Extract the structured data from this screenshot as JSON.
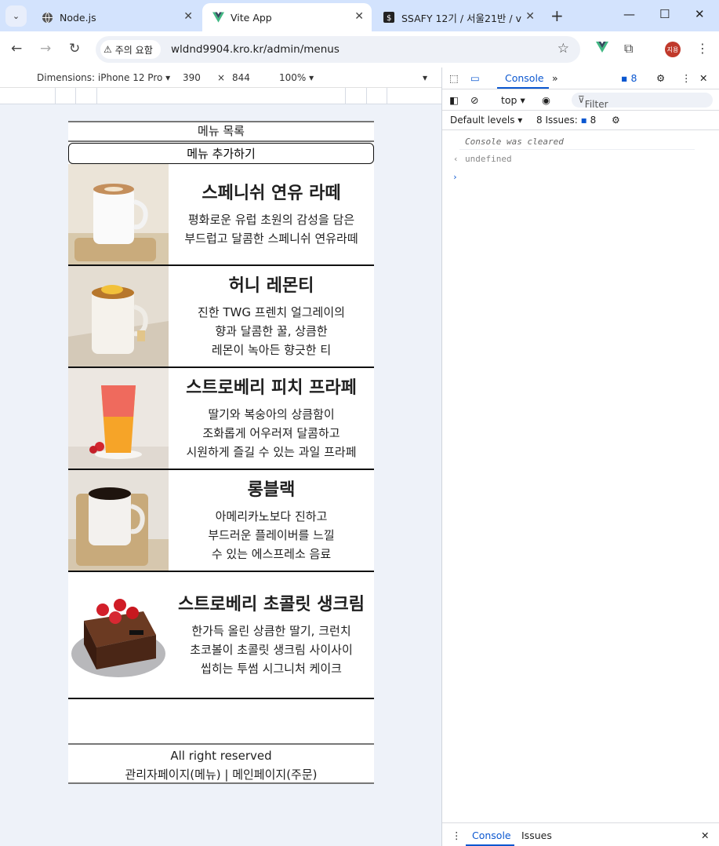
{
  "browser": {
    "tabs": [
      {
        "title": "Node.js",
        "active": false
      },
      {
        "title": "Vite App",
        "active": true
      },
      {
        "title": "SSAFY 12기 / 서울21반 / v",
        "active": false
      }
    ],
    "security_chip": "주의 요함",
    "url": "wldnd9904.kro.kr/admin/menus",
    "profile_initials": "지용"
  },
  "device_toolbar": {
    "dimensions_label": "Dimensions: iPhone 12 Pro",
    "width": "390",
    "times": "×",
    "height": "844",
    "zoom": "100%"
  },
  "app": {
    "header_title": "메뉴 목록",
    "add_button": "메뉴 추가하기",
    "menus": [
      {
        "name": "스페니쉬 연유 라떼",
        "desc_lines": [
          "평화로운 유럽 초원의 감성을 담은",
          "부드럽고 달콤한 스페니쉬 연유라떼"
        ]
      },
      {
        "name": "허니 레몬티",
        "desc_lines": [
          "진한 TWG 프렌치 얼그레이의",
          "향과 달콤한 꿀, 상큼한",
          "레몬이 녹아든 향긋한 티"
        ]
      },
      {
        "name": "스트로베리 피치 프라페",
        "desc_lines": [
          "딸기와 복숭아의 상큼함이",
          "조화롭게 어우러져 달콤하고",
          "시원하게 즐길 수 있는 과일 프라페"
        ]
      },
      {
        "name": "롱블랙",
        "desc_lines": [
          "아메리카노보다 진하고",
          "부드러운 플레이버를 느낄",
          "수 있는 에스프레소 음료"
        ]
      },
      {
        "name": "스트로베리 초콜릿 생크림",
        "desc_lines": [
          "한가득 올린 상큼한 딸기, 크런치",
          "초코볼이 초콜릿 생크림 사이사이",
          "씹히는 투썸 시그니처 케이크"
        ]
      }
    ],
    "footer_line1": "All right reserved",
    "footer_line2": "관리자페이지(메뉴) | 메인페이지(주문)"
  },
  "devtools": {
    "tab_console": "Console",
    "issues_badge": "8",
    "context": "top",
    "filter_placeholder": "Filter",
    "levels": "Default levels",
    "issues_label": "8 Issues:",
    "issues_count": "8",
    "log_cleared": "Console was cleared",
    "log_undefined": "undefined",
    "drawer_console": "Console",
    "drawer_issues": "Issues"
  },
  "colors": {
    "accent": "#0b57d0",
    "tabstrip": "#d3e3fd",
    "vite_logo": "#41b883"
  }
}
